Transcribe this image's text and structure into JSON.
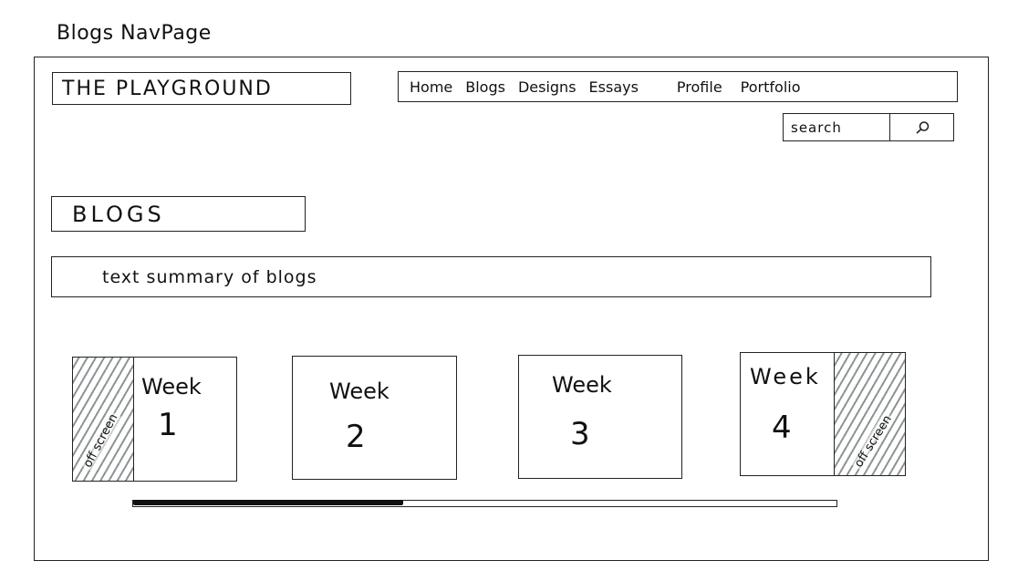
{
  "sketch_title": "Blogs NavPage",
  "header": {
    "logo": "THE PLAYGROUND",
    "nav": [
      "Home",
      "Blogs",
      "Designs",
      "Essays",
      "Profile",
      "Portfolio"
    ]
  },
  "search": {
    "placeholder": "search",
    "icon": "search-icon"
  },
  "page": {
    "section_title": "BLOGS",
    "summary": "text summary of blogs"
  },
  "cards": [
    {
      "label": "Week",
      "number": "1"
    },
    {
      "label": "Week",
      "number": "2"
    },
    {
      "label": "Week",
      "number": "3"
    },
    {
      "label": "Week",
      "number": "4"
    }
  ],
  "offscreen_label": "off screen",
  "scrollbar": {
    "position": 0.38
  },
  "colors": {
    "ink": "#222222",
    "hatch": "#8d9496"
  }
}
